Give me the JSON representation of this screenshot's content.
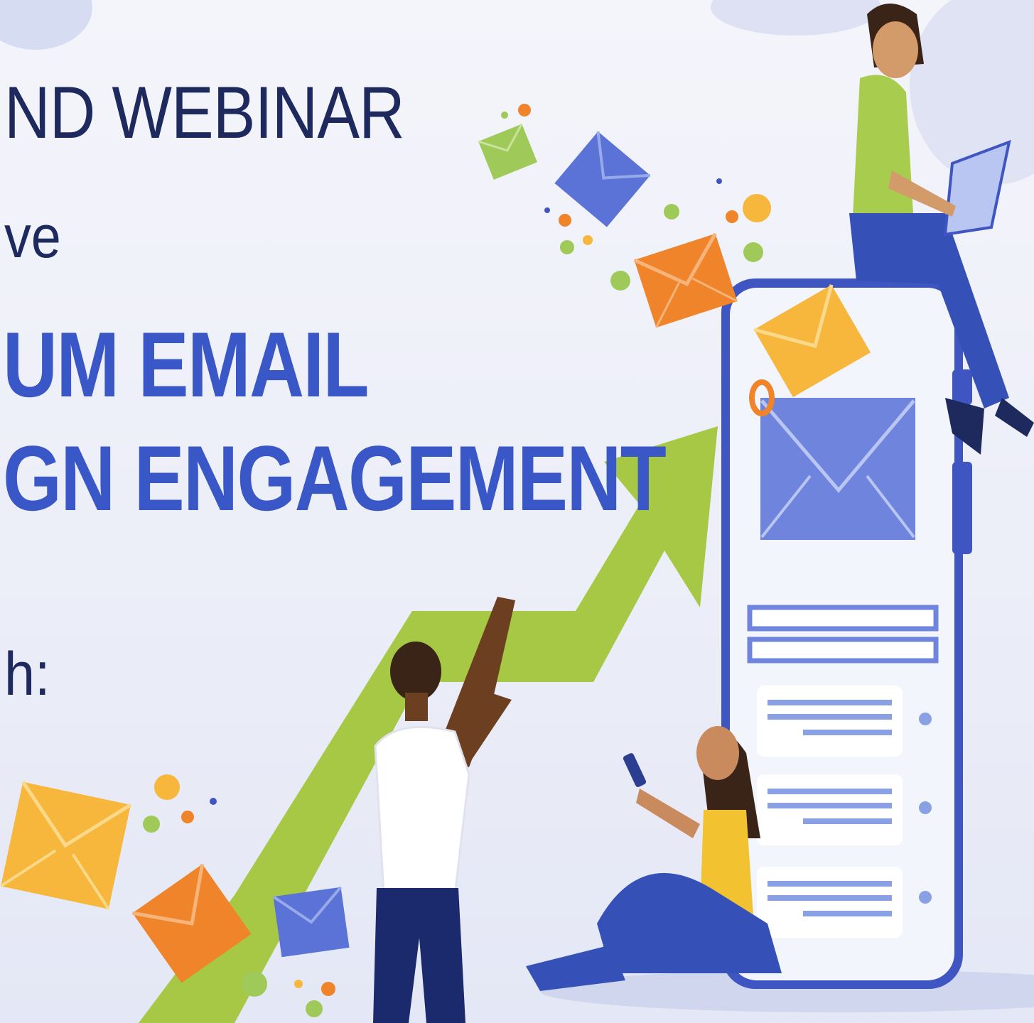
{
  "banner": {
    "line1": "ND WEBINAR",
    "line2": "ve",
    "line3": "UM EMAIL",
    "line4": "GN ENGAGEMENT",
    "line5": "h:"
  },
  "colors": {
    "background": "#eef0f8",
    "heading_dark": "#1e2a5e",
    "heading_blue": "#3a57c8",
    "arrow_green": "#a6c845",
    "envelope_orange": "#f0842a",
    "envelope_yellow": "#f6b73c",
    "envelope_blue": "#5b72d6",
    "envelope_green": "#9fca5a",
    "phone_frame": "#3f56c2"
  },
  "icons": [
    "email-envelope-icon",
    "growth-arrow-icon",
    "smartphone-icon",
    "laptop-icon"
  ]
}
